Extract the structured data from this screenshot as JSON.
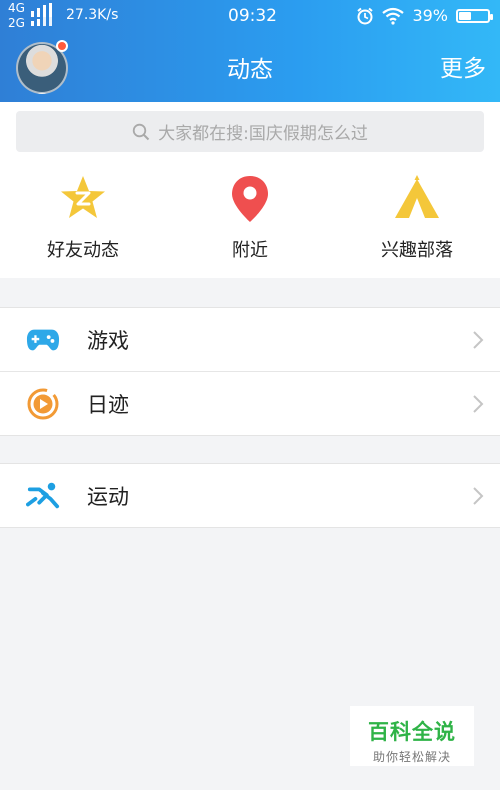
{
  "status_bar": {
    "network_top": "4G",
    "network_bottom": "2G",
    "speed": "27.3K/s",
    "time": "09:32",
    "battery": "39%",
    "battery_level": 0.39,
    "icons": [
      "signal-icon",
      "alarm-icon",
      "wifi-icon",
      "battery-icon"
    ]
  },
  "header": {
    "title": "动态",
    "more_label": "更多",
    "avatar_has_notification": true
  },
  "search": {
    "placeholder": "大家都在搜:国庆假期怎么过",
    "icon": "search-icon"
  },
  "quick_actions": [
    {
      "label": "好友动态",
      "icon": "star-z-icon",
      "color": "#f4c73a"
    },
    {
      "label": "附近",
      "icon": "location-pin-icon",
      "color": "#ef4f4f"
    },
    {
      "label": "兴趣部落",
      "icon": "tent-icon",
      "color": "#f4c73a"
    }
  ],
  "list_groups": [
    [
      {
        "label": "游戏",
        "icon": "gamepad-icon",
        "color": "#2ea8e8"
      },
      {
        "label": "日迹",
        "icon": "play-circle-icon",
        "color": "#f29a35"
      }
    ],
    [
      {
        "label": "运动",
        "icon": "runner-icon",
        "color": "#1d9fe2"
      }
    ]
  ],
  "watermark": {
    "title": "百科全说",
    "subtitle": "助你轻松解决"
  },
  "colors": {
    "header_gradient_start": "#2f7fd6",
    "header_gradient_end": "#33b8f7",
    "background": "#f3f4f6",
    "watermark_green": "#2fb347"
  }
}
